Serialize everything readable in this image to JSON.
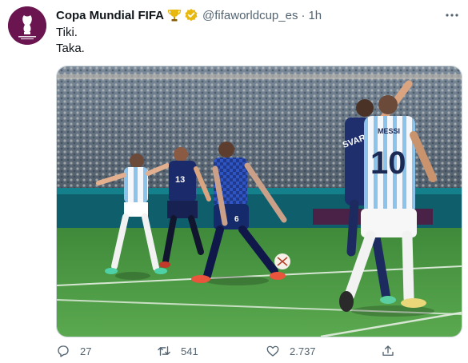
{
  "tweet": {
    "display_name": "Copa Mundial FIFA",
    "handle": "@fifaworldcup_es",
    "separator": "·",
    "time": "1h",
    "lines": [
      "Tiki.",
      "Taka."
    ]
  },
  "icons": {
    "avatar": "fifa-world-cup-trophy-logo",
    "badge": "trophy-emoji-icon",
    "verified": "verified-badge-icon",
    "more": "more-icon",
    "reply": "reply-icon",
    "retweet": "retweet-icon",
    "like": "heart-icon",
    "share": "share-icon"
  },
  "actions": {
    "replies": "27",
    "retweets": "541",
    "likes": "2.737"
  },
  "media": {
    "jerseys": [
      "13",
      "6",
      "10"
    ],
    "player_names": [
      "SVARDIOL",
      "MESSI"
    ]
  },
  "colors": {
    "avatar_bg": "#6b1550",
    "verified": "#e8b80f",
    "pitch": "#4d9a45",
    "muted": "#536471"
  }
}
